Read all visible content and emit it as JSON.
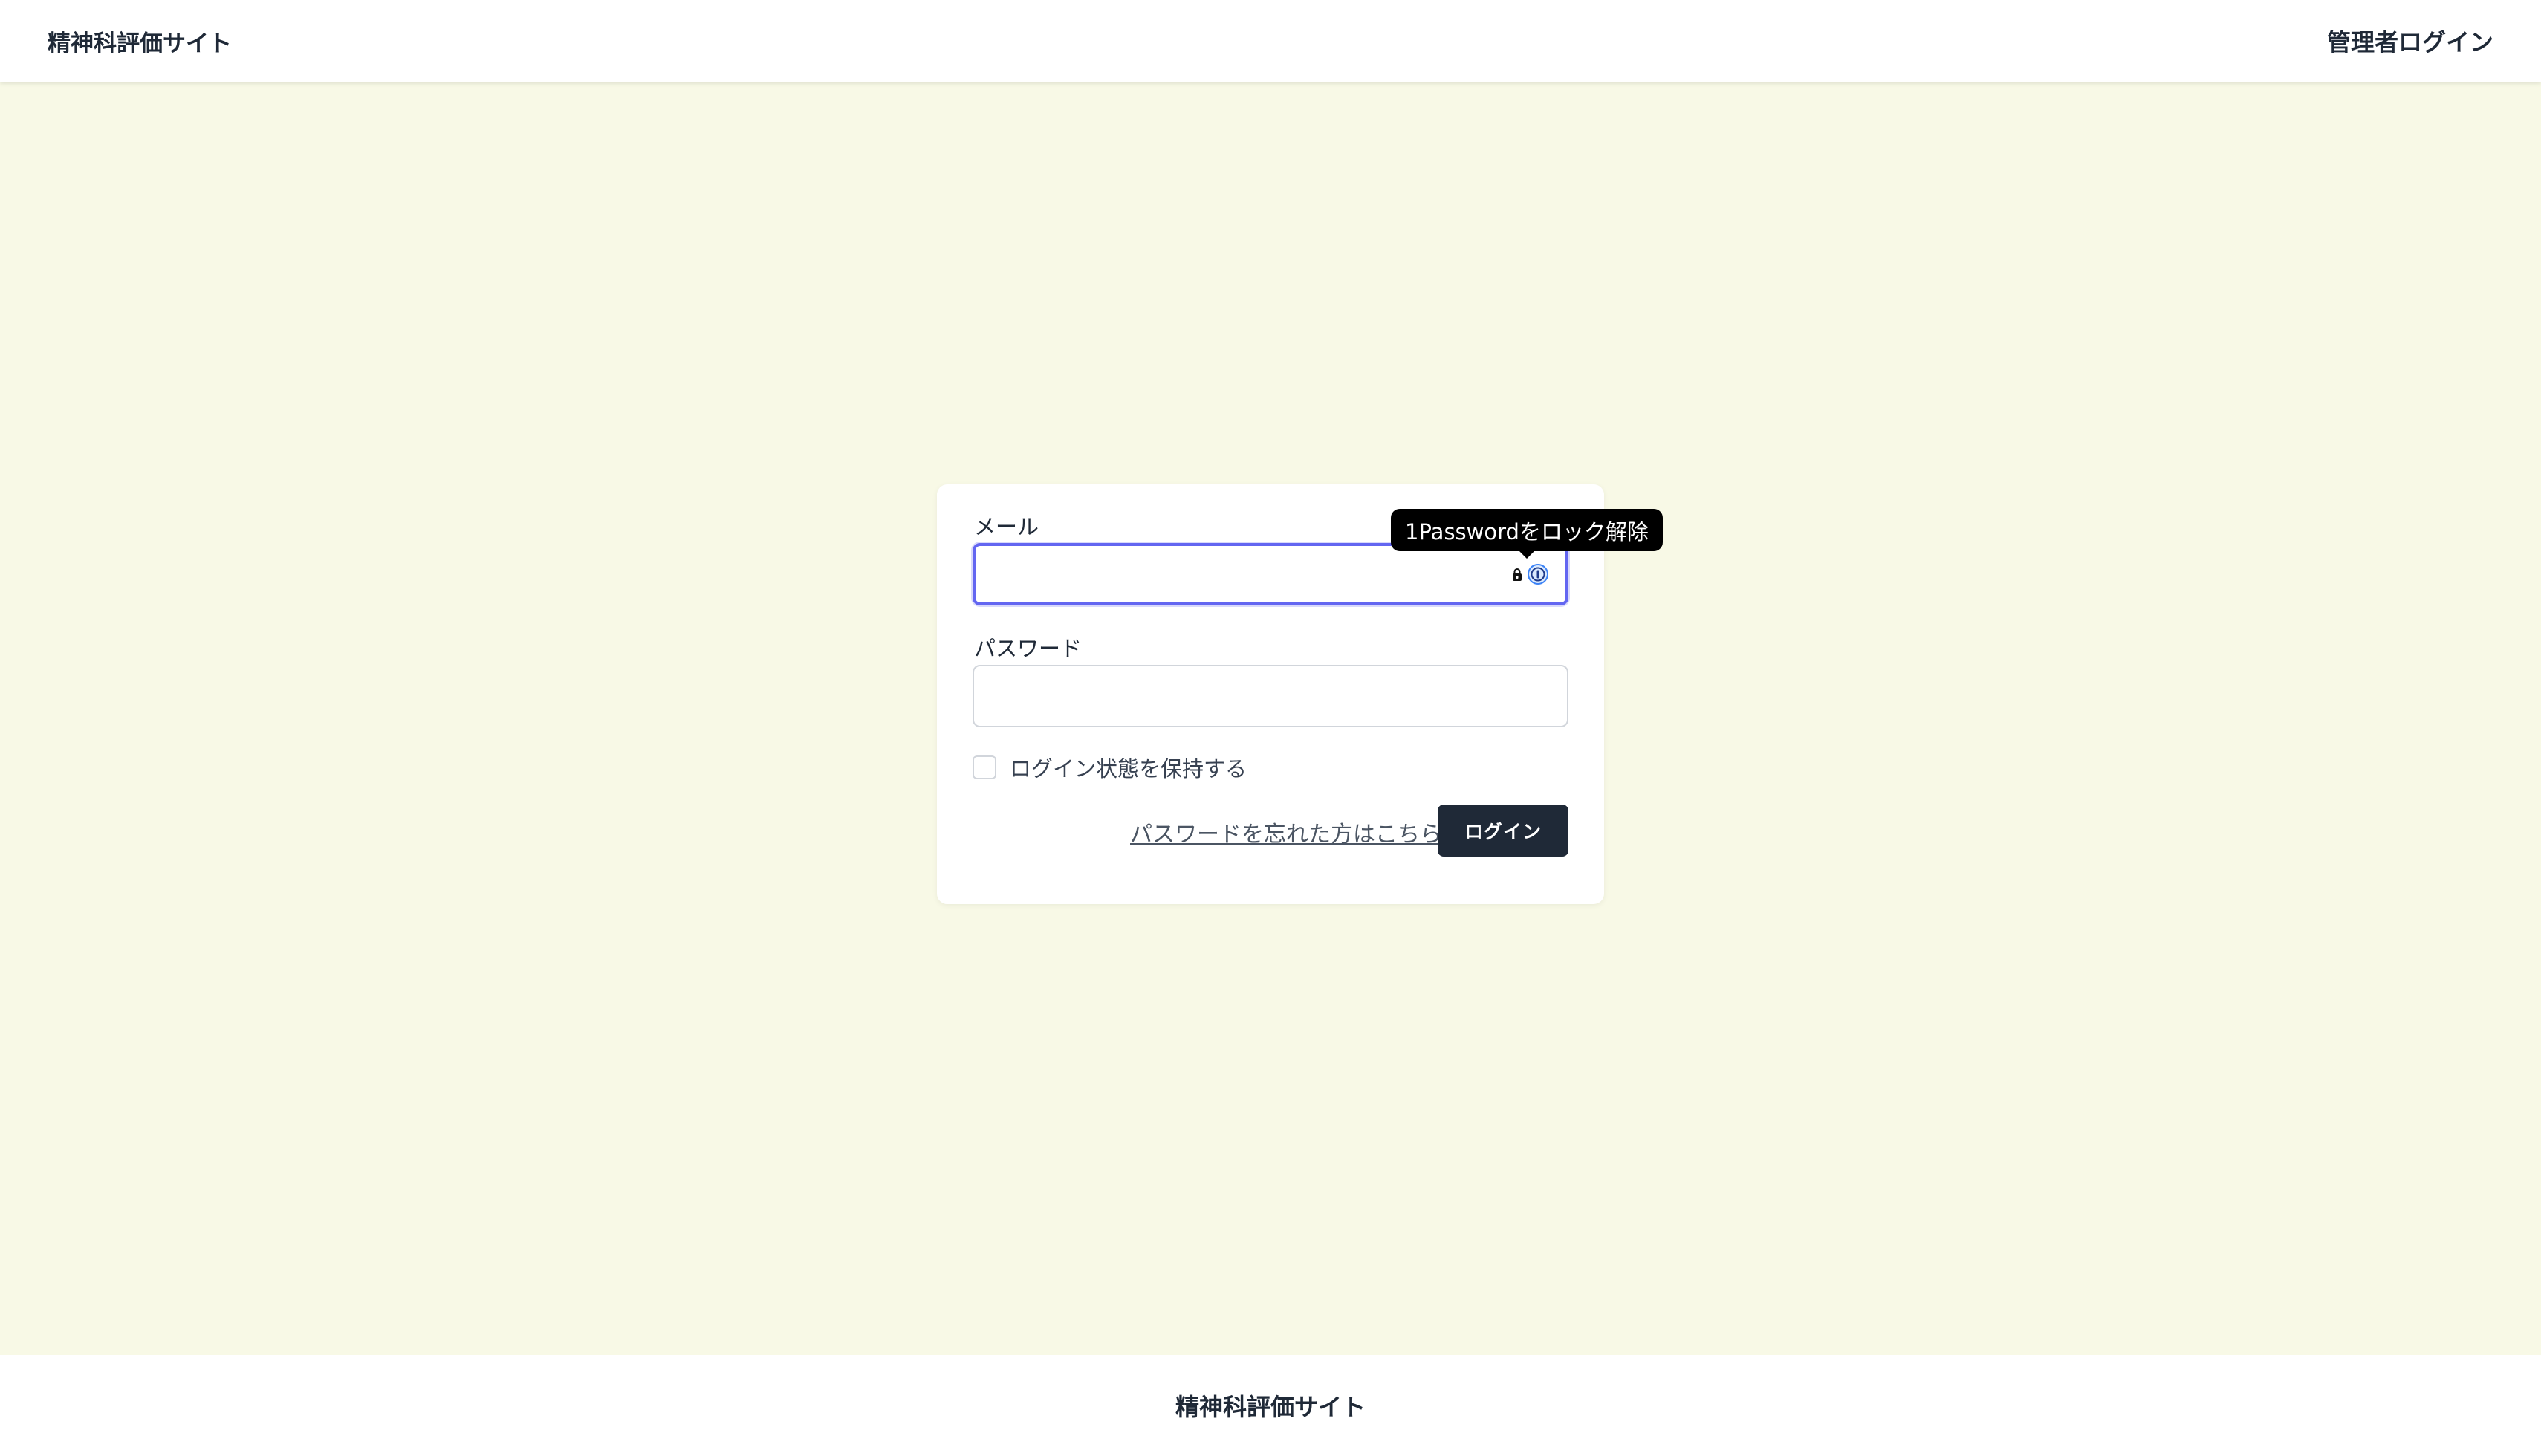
{
  "header": {
    "site_title": "精神科評価サイト",
    "admin_login": "管理者ログイン"
  },
  "login_form": {
    "email_label": "メール",
    "email_value": "",
    "password_label": "パスワード",
    "password_value": "",
    "remember_label": "ログイン状態を保持する",
    "remember_checked": false,
    "forgot_password": "パスワードを忘れた方はこちら",
    "submit_label": "ログイン"
  },
  "tooltip": {
    "text": "1Passwordをロック解除"
  },
  "icons": {
    "lock": "lock-icon",
    "password_manager": "1password-icon"
  },
  "footer": {
    "site_title": "精神科評価サイト"
  },
  "colors": {
    "background": "#f8f9e6",
    "focus_ring": "#6366f1",
    "button": "#1f2937"
  }
}
